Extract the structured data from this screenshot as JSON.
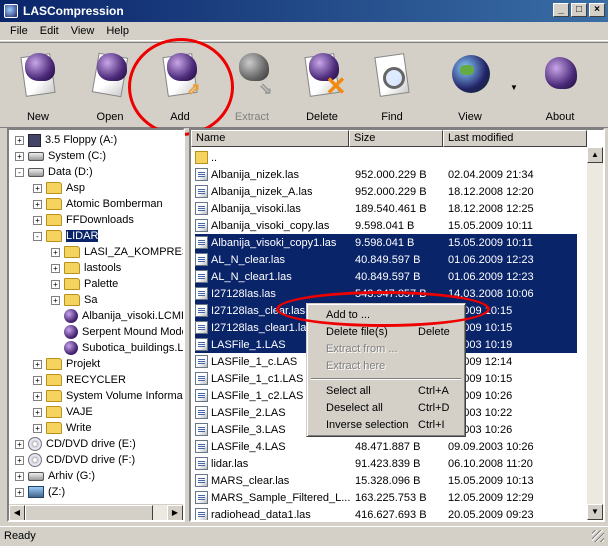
{
  "window": {
    "title": "LASCompression"
  },
  "menu": [
    "File",
    "Edit",
    "View",
    "Help"
  ],
  "toolbar": {
    "new": "New",
    "open": "Open",
    "add": "Add",
    "extract": "Extract",
    "delete": "Delete",
    "find": "Find",
    "view": "View",
    "about": "About"
  },
  "tree": [
    {
      "label": "3.5 Floppy (A:)",
      "icon": "floppy",
      "depth": 0,
      "expander": "+"
    },
    {
      "label": "System (C:)",
      "icon": "drive",
      "depth": 0,
      "expander": "+"
    },
    {
      "label": "Data (D:)",
      "icon": "drive",
      "depth": 0,
      "expander": "-"
    },
    {
      "label": "Asp",
      "icon": "folder",
      "depth": 1,
      "expander": "+"
    },
    {
      "label": "Atomic Bomberman",
      "icon": "folder",
      "depth": 1,
      "expander": "+"
    },
    {
      "label": "FFDownloads",
      "icon": "folder",
      "depth": 1,
      "expander": "+"
    },
    {
      "label": "LIDAR",
      "icon": "folder",
      "depth": 1,
      "expander": "-",
      "selected": true
    },
    {
      "label": "LASI_ZA_KOMPRESI",
      "icon": "folder",
      "depth": 2,
      "expander": "+"
    },
    {
      "label": "lastools",
      "icon": "folder",
      "depth": 2,
      "expander": "+"
    },
    {
      "label": "Palette",
      "icon": "folder",
      "depth": 2,
      "expander": "+"
    },
    {
      "label": "Sa",
      "icon": "folder",
      "depth": 2,
      "expander": "+"
    },
    {
      "label": "Albanija_visoki.LCMP",
      "icon": "lasfile",
      "depth": 2,
      "expander": ""
    },
    {
      "label": "Serpent Mound Mode",
      "icon": "lasfile",
      "depth": 2,
      "expander": ""
    },
    {
      "label": "Subotica_buildings.LC",
      "icon": "lasfile",
      "depth": 2,
      "expander": ""
    },
    {
      "label": "Projekt",
      "icon": "folder",
      "depth": 1,
      "expander": "+"
    },
    {
      "label": "RECYCLER",
      "icon": "folder",
      "depth": 1,
      "expander": "+"
    },
    {
      "label": "System Volume Informat",
      "icon": "folder",
      "depth": 1,
      "expander": "+"
    },
    {
      "label": "VAJE",
      "icon": "folder",
      "depth": 1,
      "expander": "+"
    },
    {
      "label": "Write",
      "icon": "folder",
      "depth": 1,
      "expander": "+"
    },
    {
      "label": "CD/DVD drive (E:)",
      "icon": "cd",
      "depth": 0,
      "expander": "+"
    },
    {
      "label": "CD/DVD drive (F:)",
      "icon": "cd",
      "depth": 0,
      "expander": "+"
    },
    {
      "label": "Arhiv (G:)",
      "icon": "drive",
      "depth": 0,
      "expander": "+"
    },
    {
      "label": "(Z:)",
      "icon": "net",
      "depth": 0,
      "expander": "+"
    }
  ],
  "list": {
    "columns": [
      "Name",
      "Size",
      "Last modified"
    ],
    "rows": [
      {
        "name": "..",
        "size": "",
        "modified": "",
        "folder": true
      },
      {
        "name": "Albanija_nizek.las",
        "size": "952.000.229 B",
        "modified": "02.04.2009 21:34"
      },
      {
        "name": "Albanija_nizek_A.las",
        "size": "952.000.229 B",
        "modified": "18.12.2008 12:20"
      },
      {
        "name": "Albanija_visoki.las",
        "size": "189.540.461 B",
        "modified": "18.12.2008 12:25"
      },
      {
        "name": "Albanija_visoki_copy.las",
        "size": "9.598.041 B",
        "modified": "15.05.2009 10:11"
      },
      {
        "name": "Albanija_visoki_copy1.las",
        "size": "9.598.041 B",
        "modified": "15.05.2009 10:11",
        "selected": true
      },
      {
        "name": "AL_N_clear.las",
        "size": "40.849.597 B",
        "modified": "01.06.2009 12:23",
        "selected": true
      },
      {
        "name": "AL_N_clear1.las",
        "size": "40.849.597 B",
        "modified": "01.06.2009 12:23",
        "selected": true
      },
      {
        "name": "I27128las.las",
        "size": "543.947.857 B",
        "modified": "14.03.2008 10:06",
        "selected": true
      },
      {
        "name": "I27128las_clear.las",
        "size": "",
        "modified": "5.2009 10:15",
        "selected": true
      },
      {
        "name": "I27128las_clear1.las",
        "size": "",
        "modified": "5.2009 10:15",
        "selected": true
      },
      {
        "name": "LASFile_1.LAS",
        "size": "",
        "modified": "9.2003 10:19",
        "selected": true
      },
      {
        "name": "LASFile_1_c.LAS",
        "size": "",
        "modified": "5.2009 12:14"
      },
      {
        "name": "LASFile_1_c1.LAS",
        "size": "",
        "modified": "5.2009 10:15"
      },
      {
        "name": "LASFile_1_c2.LAS",
        "size": "",
        "modified": "5.2009 10:26"
      },
      {
        "name": "LASFile_2.LAS",
        "size": "",
        "modified": "9.2003 10:22"
      },
      {
        "name": "LASFile_3.LAS",
        "size": "",
        "modified": "9.2003 10:26"
      },
      {
        "name": "LASFile_4.LAS",
        "size": "48.471.887 B",
        "modified": "09.09.2003 10:26"
      },
      {
        "name": "lidar.las",
        "size": "91.423.839 B",
        "modified": "06.10.2008 11:20"
      },
      {
        "name": "MARS_clear.las",
        "size": "15.328.096 B",
        "modified": "15.05.2009 10:13"
      },
      {
        "name": "MARS_Sample_Filtered_L...",
        "size": "163.225.753 B",
        "modified": "12.05.2009 12:29"
      },
      {
        "name": "radiohead_data1.las",
        "size": "416.627.693 B",
        "modified": "20.05.2009 09:23"
      }
    ]
  },
  "context_menu": [
    {
      "label": "Add to ...",
      "shortcut": "",
      "enabled": true
    },
    {
      "label": "Delete file(s)",
      "shortcut": "Delete",
      "enabled": true
    },
    {
      "label": "Extract from ...",
      "shortcut": "",
      "enabled": false
    },
    {
      "label": "Extract here",
      "shortcut": "",
      "enabled": false
    },
    {
      "separator": true
    },
    {
      "label": "Select all",
      "shortcut": "Ctrl+A",
      "enabled": true
    },
    {
      "label": "Deselect all",
      "shortcut": "Ctrl+D",
      "enabled": true
    },
    {
      "label": "Inverse selection",
      "shortcut": "Ctrl+I",
      "enabled": true
    }
  ],
  "status": {
    "text": "Ready"
  },
  "colors": {
    "selection": "#0a246a",
    "annotation": "#e00000",
    "face": "#d4d0c8"
  }
}
